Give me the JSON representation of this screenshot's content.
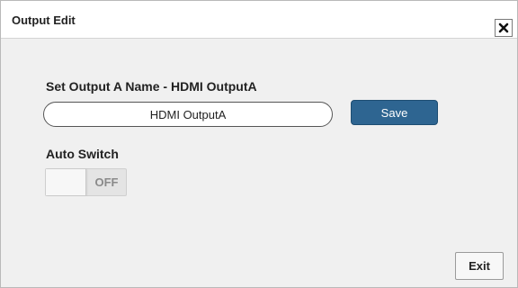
{
  "dialog": {
    "title": "Output Edit",
    "close_icon": "close-x-icon"
  },
  "output_name": {
    "label": "Set Output A Name - HDMI OutputA",
    "value": "HDMI OutputA",
    "save_label": "Save"
  },
  "auto_switch": {
    "label": "Auto Switch",
    "state": "OFF"
  },
  "footer": {
    "exit_label": "Exit"
  },
  "colors": {
    "save_button": "#2e6591",
    "dialog_background": "#f0f0f0"
  }
}
